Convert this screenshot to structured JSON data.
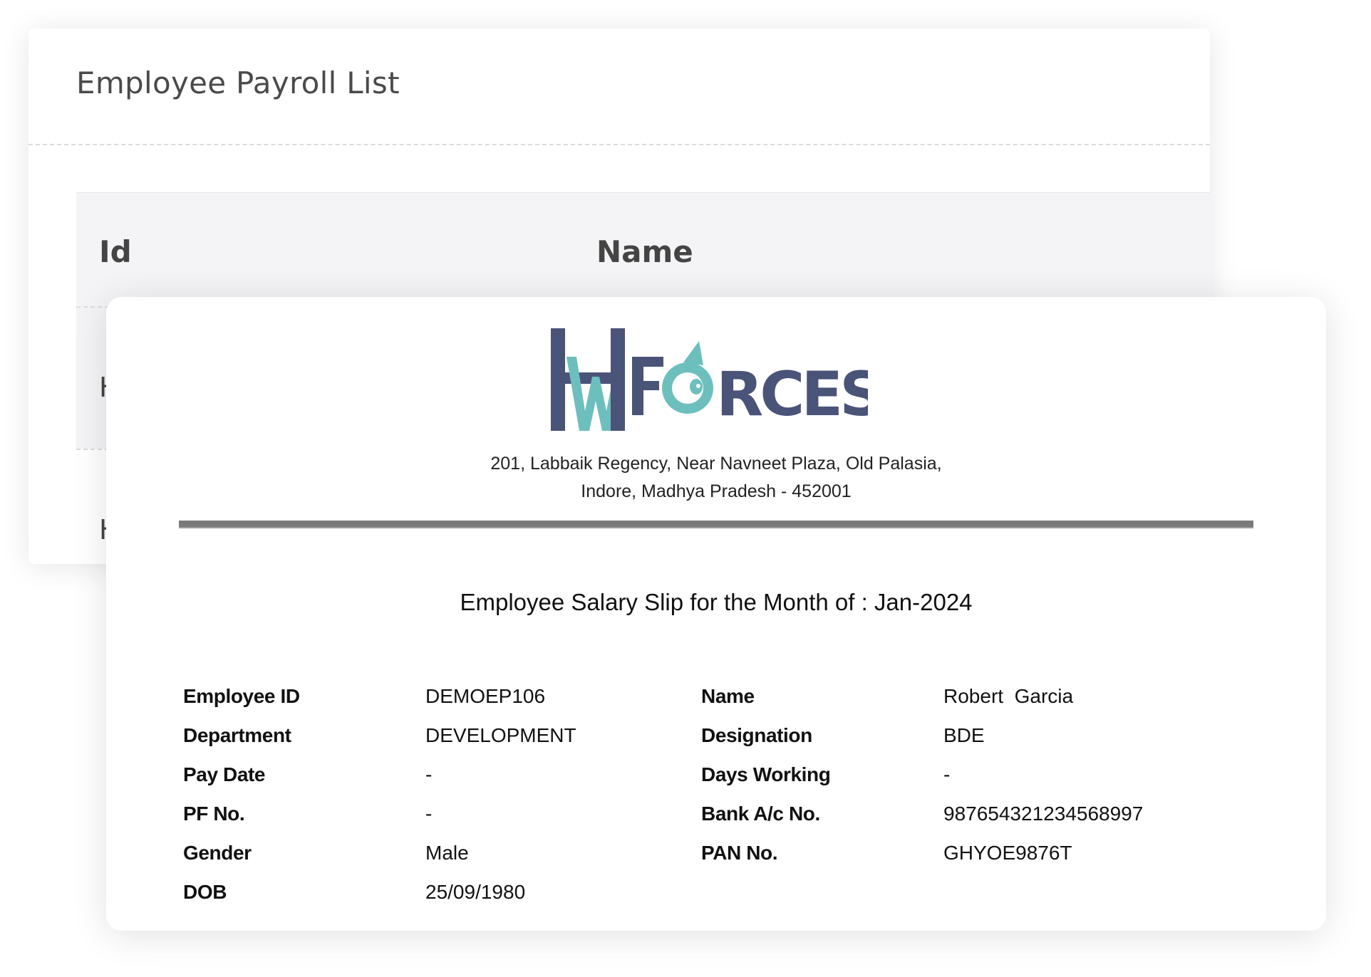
{
  "payroll_list": {
    "title": "Employee Payroll List",
    "columns": [
      "Id",
      "Name"
    ],
    "rows": [
      "H",
      "H"
    ]
  },
  "slip": {
    "address_line1": "201, Labbaik Regency, Near Navneet Plaza, Old Palasia,",
    "address_line2": "Indore, Madhya Pradesh - 452001",
    "title": "Employee Salary Slip for the Month of : Jan-2024",
    "details": [
      {
        "l1": "Employee ID",
        "v1": "DEMOEP106",
        "l2": "Name",
        "v2": "Robert  Garcia"
      },
      {
        "l1": "Department",
        "v1": "DEVELOPMENT",
        "l2": "Designation",
        "v2": "BDE"
      },
      {
        "l1": "Pay Date",
        "v1": "-",
        "l2": "Days Working",
        "v2": "-"
      },
      {
        "l1": "PF No.",
        "v1": "-",
        "l2": "Bank A/c No.",
        "v2": "987654321234568997"
      },
      {
        "l1": "Gender",
        "v1": "Male",
        "l2": "PAN No.",
        "v2": "GHYOE9876T"
      },
      {
        "l1": "DOB",
        "v1": "25/09/1980",
        "l2": "",
        "v2": ""
      }
    ]
  },
  "logo": {
    "text": "HWFORCES",
    "icon": "hw-forces-logo",
    "colors": {
      "dark": "#4a5378",
      "teal": "#6cbfbd"
    }
  }
}
